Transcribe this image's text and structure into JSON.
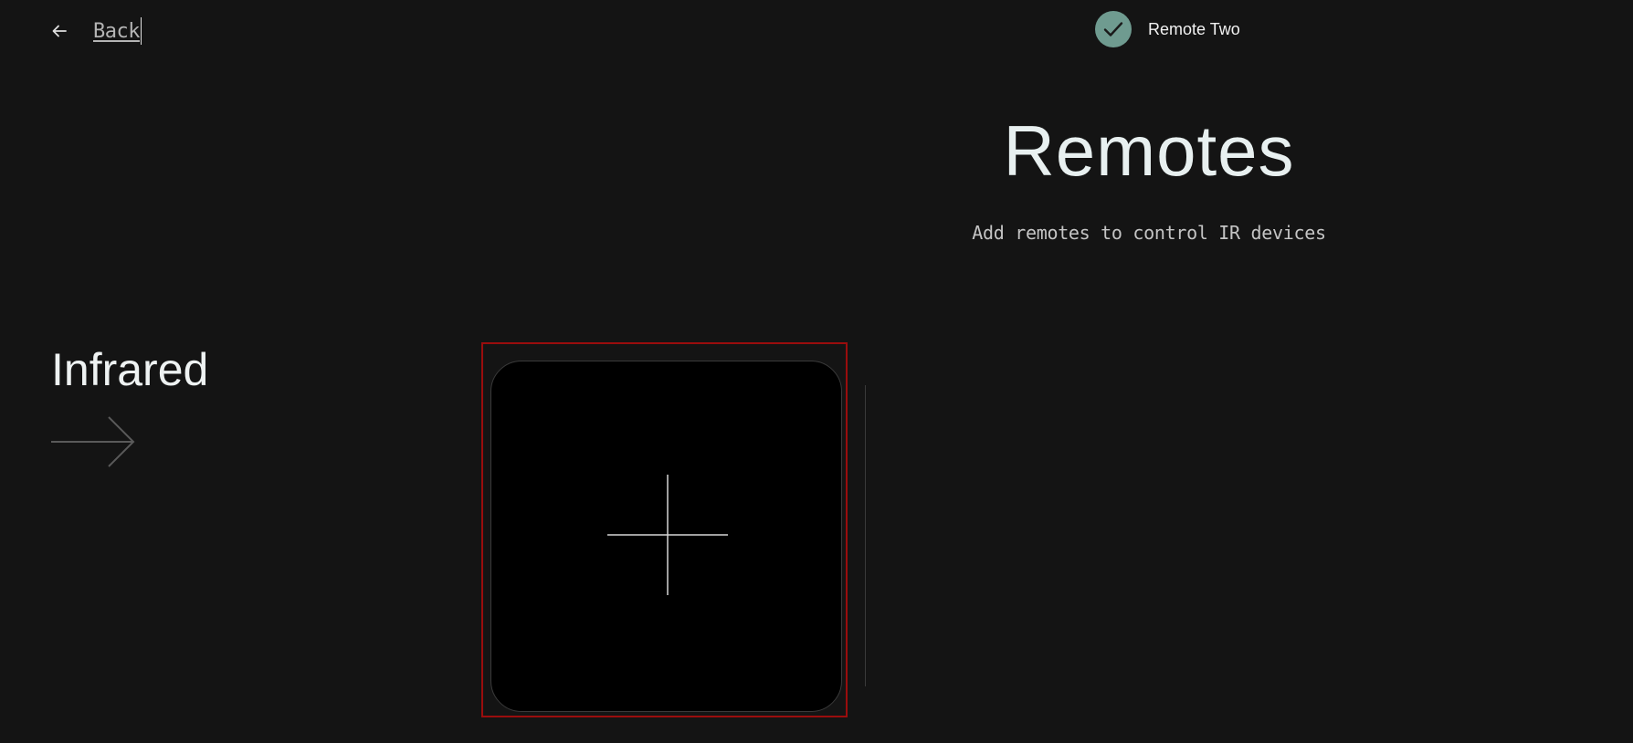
{
  "header": {
    "back_label": "Back",
    "back_icon": "arrow-left-icon"
  },
  "status": {
    "device_name": "Remote Two",
    "icon": "checkmark-icon",
    "color": "#6f9b90"
  },
  "main": {
    "title": "Remotes",
    "subtitle": "Add remotes to control IR devices"
  },
  "section": {
    "title": "Infrared",
    "arrow_icon": "arrow-right-icon",
    "add_card_icon": "plus-icon"
  },
  "colors": {
    "background": "#141414",
    "card": "#000000",
    "highlight": "#9a0d0d"
  }
}
